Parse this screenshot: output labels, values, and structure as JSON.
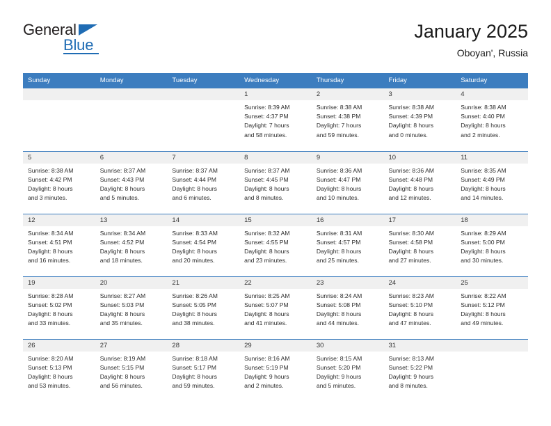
{
  "brand": {
    "name_part1": "General",
    "name_part2": "Blue",
    "triangle_icon": "triangle-icon",
    "primary_color": "#1f6cb4"
  },
  "header": {
    "title": "January 2025",
    "subtitle": "Oboyan', Russia"
  },
  "theme": {
    "header_blue": "#3c7dbf",
    "daynum_band": "#f0f0f0",
    "text": "#2b2b2b"
  },
  "weekday_headers": [
    "Sunday",
    "Monday",
    "Tuesday",
    "Wednesday",
    "Thursday",
    "Friday",
    "Saturday"
  ],
  "weeks": [
    [
      {
        "day": "",
        "empty": true
      },
      {
        "day": "",
        "empty": true
      },
      {
        "day": "",
        "empty": true
      },
      {
        "day": "1",
        "sunrise": "Sunrise: 8:39 AM",
        "sunset": "Sunset: 4:37 PM",
        "daylight_line1": "Daylight: 7 hours",
        "daylight_line2": "and 58 minutes."
      },
      {
        "day": "2",
        "sunrise": "Sunrise: 8:38 AM",
        "sunset": "Sunset: 4:38 PM",
        "daylight_line1": "Daylight: 7 hours",
        "daylight_line2": "and 59 minutes."
      },
      {
        "day": "3",
        "sunrise": "Sunrise: 8:38 AM",
        "sunset": "Sunset: 4:39 PM",
        "daylight_line1": "Daylight: 8 hours",
        "daylight_line2": "and 0 minutes."
      },
      {
        "day": "4",
        "sunrise": "Sunrise: 8:38 AM",
        "sunset": "Sunset: 4:40 PM",
        "daylight_line1": "Daylight: 8 hours",
        "daylight_line2": "and 2 minutes."
      }
    ],
    [
      {
        "day": "5",
        "sunrise": "Sunrise: 8:38 AM",
        "sunset": "Sunset: 4:42 PM",
        "daylight_line1": "Daylight: 8 hours",
        "daylight_line2": "and 3 minutes."
      },
      {
        "day": "6",
        "sunrise": "Sunrise: 8:37 AM",
        "sunset": "Sunset: 4:43 PM",
        "daylight_line1": "Daylight: 8 hours",
        "daylight_line2": "and 5 minutes."
      },
      {
        "day": "7",
        "sunrise": "Sunrise: 8:37 AM",
        "sunset": "Sunset: 4:44 PM",
        "daylight_line1": "Daylight: 8 hours",
        "daylight_line2": "and 6 minutes."
      },
      {
        "day": "8",
        "sunrise": "Sunrise: 8:37 AM",
        "sunset": "Sunset: 4:45 PM",
        "daylight_line1": "Daylight: 8 hours",
        "daylight_line2": "and 8 minutes."
      },
      {
        "day": "9",
        "sunrise": "Sunrise: 8:36 AM",
        "sunset": "Sunset: 4:47 PM",
        "daylight_line1": "Daylight: 8 hours",
        "daylight_line2": "and 10 minutes."
      },
      {
        "day": "10",
        "sunrise": "Sunrise: 8:36 AM",
        "sunset": "Sunset: 4:48 PM",
        "daylight_line1": "Daylight: 8 hours",
        "daylight_line2": "and 12 minutes."
      },
      {
        "day": "11",
        "sunrise": "Sunrise: 8:35 AM",
        "sunset": "Sunset: 4:49 PM",
        "daylight_line1": "Daylight: 8 hours",
        "daylight_line2": "and 14 minutes."
      }
    ],
    [
      {
        "day": "12",
        "sunrise": "Sunrise: 8:34 AM",
        "sunset": "Sunset: 4:51 PM",
        "daylight_line1": "Daylight: 8 hours",
        "daylight_line2": "and 16 minutes."
      },
      {
        "day": "13",
        "sunrise": "Sunrise: 8:34 AM",
        "sunset": "Sunset: 4:52 PM",
        "daylight_line1": "Daylight: 8 hours",
        "daylight_line2": "and 18 minutes."
      },
      {
        "day": "14",
        "sunrise": "Sunrise: 8:33 AM",
        "sunset": "Sunset: 4:54 PM",
        "daylight_line1": "Daylight: 8 hours",
        "daylight_line2": "and 20 minutes."
      },
      {
        "day": "15",
        "sunrise": "Sunrise: 8:32 AM",
        "sunset": "Sunset: 4:55 PM",
        "daylight_line1": "Daylight: 8 hours",
        "daylight_line2": "and 23 minutes."
      },
      {
        "day": "16",
        "sunrise": "Sunrise: 8:31 AM",
        "sunset": "Sunset: 4:57 PM",
        "daylight_line1": "Daylight: 8 hours",
        "daylight_line2": "and 25 minutes."
      },
      {
        "day": "17",
        "sunrise": "Sunrise: 8:30 AM",
        "sunset": "Sunset: 4:58 PM",
        "daylight_line1": "Daylight: 8 hours",
        "daylight_line2": "and 27 minutes."
      },
      {
        "day": "18",
        "sunrise": "Sunrise: 8:29 AM",
        "sunset": "Sunset: 5:00 PM",
        "daylight_line1": "Daylight: 8 hours",
        "daylight_line2": "and 30 minutes."
      }
    ],
    [
      {
        "day": "19",
        "sunrise": "Sunrise: 8:28 AM",
        "sunset": "Sunset: 5:02 PM",
        "daylight_line1": "Daylight: 8 hours",
        "daylight_line2": "and 33 minutes."
      },
      {
        "day": "20",
        "sunrise": "Sunrise: 8:27 AM",
        "sunset": "Sunset: 5:03 PM",
        "daylight_line1": "Daylight: 8 hours",
        "daylight_line2": "and 35 minutes."
      },
      {
        "day": "21",
        "sunrise": "Sunrise: 8:26 AM",
        "sunset": "Sunset: 5:05 PM",
        "daylight_line1": "Daylight: 8 hours",
        "daylight_line2": "and 38 minutes."
      },
      {
        "day": "22",
        "sunrise": "Sunrise: 8:25 AM",
        "sunset": "Sunset: 5:07 PM",
        "daylight_line1": "Daylight: 8 hours",
        "daylight_line2": "and 41 minutes."
      },
      {
        "day": "23",
        "sunrise": "Sunrise: 8:24 AM",
        "sunset": "Sunset: 5:08 PM",
        "daylight_line1": "Daylight: 8 hours",
        "daylight_line2": "and 44 minutes."
      },
      {
        "day": "24",
        "sunrise": "Sunrise: 8:23 AM",
        "sunset": "Sunset: 5:10 PM",
        "daylight_line1": "Daylight: 8 hours",
        "daylight_line2": "and 47 minutes."
      },
      {
        "day": "25",
        "sunrise": "Sunrise: 8:22 AM",
        "sunset": "Sunset: 5:12 PM",
        "daylight_line1": "Daylight: 8 hours",
        "daylight_line2": "and 49 minutes."
      }
    ],
    [
      {
        "day": "26",
        "sunrise": "Sunrise: 8:20 AM",
        "sunset": "Sunset: 5:13 PM",
        "daylight_line1": "Daylight: 8 hours",
        "daylight_line2": "and 53 minutes."
      },
      {
        "day": "27",
        "sunrise": "Sunrise: 8:19 AM",
        "sunset": "Sunset: 5:15 PM",
        "daylight_line1": "Daylight: 8 hours",
        "daylight_line2": "and 56 minutes."
      },
      {
        "day": "28",
        "sunrise": "Sunrise: 8:18 AM",
        "sunset": "Sunset: 5:17 PM",
        "daylight_line1": "Daylight: 8 hours",
        "daylight_line2": "and 59 minutes."
      },
      {
        "day": "29",
        "sunrise": "Sunrise: 8:16 AM",
        "sunset": "Sunset: 5:19 PM",
        "daylight_line1": "Daylight: 9 hours",
        "daylight_line2": "and 2 minutes."
      },
      {
        "day": "30",
        "sunrise": "Sunrise: 8:15 AM",
        "sunset": "Sunset: 5:20 PM",
        "daylight_line1": "Daylight: 9 hours",
        "daylight_line2": "and 5 minutes."
      },
      {
        "day": "31",
        "sunrise": "Sunrise: 8:13 AM",
        "sunset": "Sunset: 5:22 PM",
        "daylight_line1": "Daylight: 9 hours",
        "daylight_line2": "and 8 minutes."
      },
      {
        "day": "",
        "empty": true
      }
    ]
  ]
}
